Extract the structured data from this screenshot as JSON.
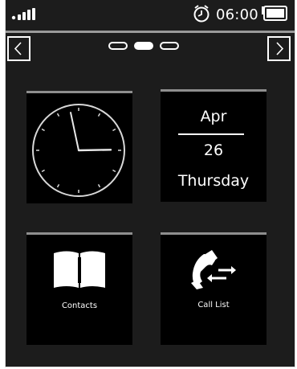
{
  "status_bar": {
    "signal_icon": "signal-strength-icon",
    "alarm_icon": "alarm-clock-icon",
    "time": "06:00",
    "battery_icon": "battery-icon",
    "battery_level": 1.0
  },
  "navigation": {
    "prev_icon": "chevron-left-icon",
    "next_icon": "chevron-right-icon",
    "page_count": 3,
    "active_page": 2
  },
  "tiles": {
    "clock": {
      "icon": "analog-clock-icon",
      "hour": 2,
      "minute": 58
    },
    "date": {
      "month": "Apr",
      "day": "26",
      "weekday": "Thursday"
    },
    "contacts": {
      "icon": "phonebook-icon",
      "label": "Contacts"
    },
    "call_list": {
      "icon": "call-list-icon",
      "label": "Call List"
    }
  },
  "colors": {
    "background": "#1c1c1c",
    "tile": "#000000",
    "text": "#ffffff",
    "accent_line": "#9a9a9a"
  }
}
